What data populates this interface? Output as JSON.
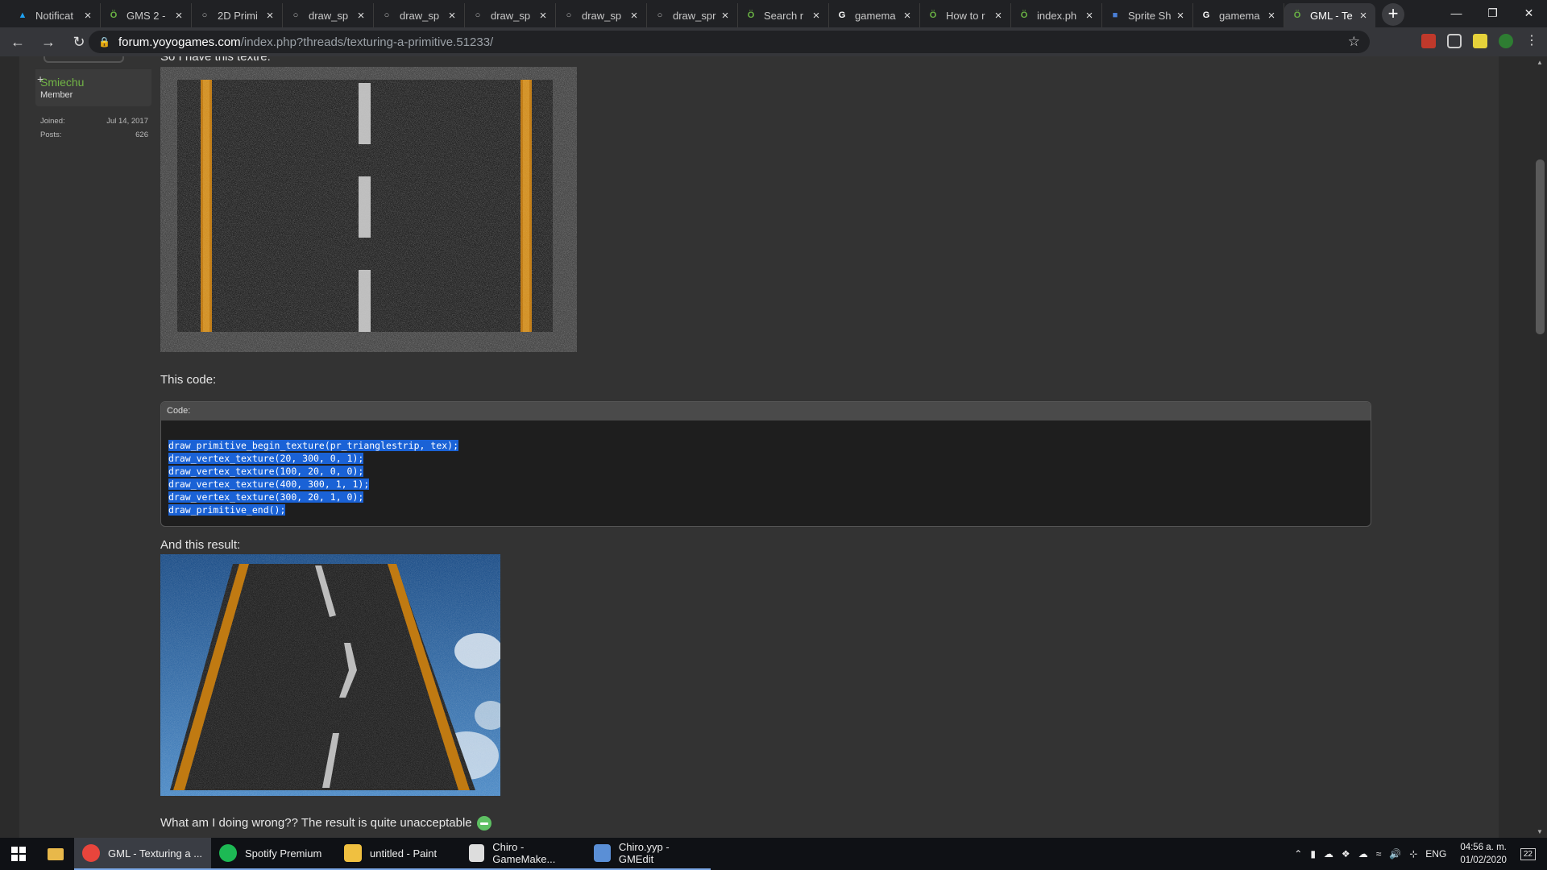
{
  "browser": {
    "tabs": [
      {
        "title": "Notificat",
        "fav": "twitter-icon"
      },
      {
        "title": "GMS 2 -",
        "fav": "yoyo-icon"
      },
      {
        "title": "2D Primi",
        "fav": "globe-icon"
      },
      {
        "title": "draw_sp",
        "fav": "globe-icon"
      },
      {
        "title": "draw_sp",
        "fav": "globe-icon"
      },
      {
        "title": "draw_sp",
        "fav": "globe-icon"
      },
      {
        "title": "draw_sp",
        "fav": "globe-icon"
      },
      {
        "title": "draw_spr",
        "fav": "globe-icon"
      },
      {
        "title": "Search r",
        "fav": "yoyo-icon"
      },
      {
        "title": "gamema",
        "fav": "google-icon"
      },
      {
        "title": "How to r",
        "fav": "yoyo-icon"
      },
      {
        "title": "index.ph",
        "fav": "yoyo-icon"
      },
      {
        "title": "Sprite Sh",
        "fav": "doc-icon"
      },
      {
        "title": "gamema",
        "fav": "google-icon"
      },
      {
        "title": "GML - Te",
        "fav": "yoyo-icon"
      }
    ],
    "url_host": "forum.yoyogames.com",
    "url_path": "/index.php?threads/texturing-a-primitive.51233/"
  },
  "user": {
    "name": "Smiechu",
    "role": "Member",
    "joined_label": "Joined:",
    "joined_value": "Jul 14, 2017",
    "posts_label": "Posts:",
    "posts_value": "626"
  },
  "post": {
    "intro": "So I have this textre:",
    "code_intro": "This code:",
    "code_header": "Code:",
    "code": "draw_primitive_begin_texture(pr_trianglestrip, tex);\ndraw_vertex_texture(20, 300, 0, 1);\ndraw_vertex_texture(100, 20, 0, 0);\ndraw_vertex_texture(400, 300, 1, 1);\ndraw_vertex_texture(300, 20, 1, 0);\ndraw_primitive_end();",
    "result_intro": "And this result:",
    "question": "What am I doing wrong?? The result is quite unacceptable"
  },
  "taskbar": {
    "items": [
      {
        "label": "GML - Texturing a ...",
        "icon": "chrome-icon"
      },
      {
        "label": "Spotify Premium",
        "icon": "spotify-icon"
      },
      {
        "label": "untitled - Paint",
        "icon": "paint-icon"
      },
      {
        "label": "Chiro - GameMake...",
        "icon": "gamemaker-icon"
      },
      {
        "label": "Chiro.yyp - GMEdit",
        "icon": "gmedit-icon"
      }
    ],
    "lang": "ENG",
    "time": "04:56 a. m.",
    "date": "01/02/2020",
    "notif_count": "22"
  }
}
